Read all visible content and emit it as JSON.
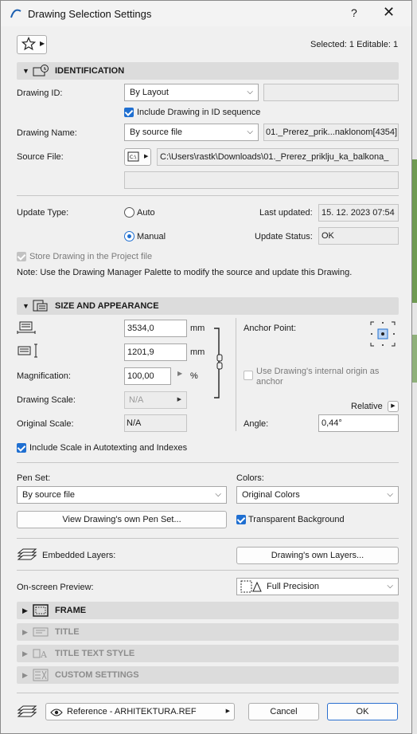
{
  "window": {
    "title": "Drawing Selection Settings",
    "help": "?",
    "close": "✕"
  },
  "status": {
    "selected": "Selected: 1 Editable: 1"
  },
  "identification": {
    "header": "IDENTIFICATION",
    "drawing_id_label": "Drawing ID:",
    "drawing_id_value": "By Layout",
    "drawing_id_extra": "",
    "include_id_label": "Include Drawing in ID sequence",
    "drawing_name_label": "Drawing Name:",
    "drawing_name_value": "By source file",
    "drawing_name_text": "01._Prerez_prik...naklonom[4354]",
    "source_file_label": "Source File:",
    "source_file_path": "C:\\Users\\rastk\\Downloads\\01._Prerez_priklju_ka_balkona_",
    "source_file_extra": "",
    "update_type_label": "Update Type:",
    "auto_label": "Auto",
    "manual_label": "Manual",
    "last_updated_label": "Last updated:",
    "last_updated_value": "15. 12. 2023 07:54",
    "update_status_label": "Update Status:",
    "update_status_value": "OK",
    "store_label": "Store Drawing in the Project file",
    "note": "Note: Use the Drawing Manager Palette to modify the source and update this Drawing."
  },
  "size": {
    "header": "SIZE AND APPEARANCE",
    "width_value": "3534,0",
    "height_value": "1201,9",
    "unit": "mm",
    "magnification_label": "Magnification:",
    "magnification_value": "100,00",
    "percent": "%",
    "drawing_scale_label": "Drawing Scale:",
    "drawing_scale_value": "N/A",
    "original_scale_label": "Original Scale:",
    "original_scale_value": "N/A",
    "anchor_label": "Anchor Point:",
    "internal_origin_label_1": "Use Drawing's internal origin as",
    "internal_origin_label_2": "anchor",
    "relative_label": "Relative",
    "angle_label": "Angle:",
    "angle_value": "0,44°",
    "include_scale_label": "Include Scale in Autotexting and Indexes"
  },
  "pens": {
    "pen_set_label": "Pen Set:",
    "pen_set_value": "By source file",
    "colors_label": "Colors:",
    "colors_value": "Original Colors",
    "view_pen_set_button": "View Drawing's own Pen Set...",
    "transparent_label": "Transparent Background"
  },
  "layers": {
    "embedded_label": "Embedded Layers:",
    "own_layers_button": "Drawing's own Layers..."
  },
  "preview": {
    "label": "On-screen Preview:",
    "value": "Full Precision"
  },
  "panels": [
    {
      "title": "FRAME"
    },
    {
      "title": "TITLE"
    },
    {
      "title": "TITLE TEXT STYLE"
    },
    {
      "title": "CUSTOM SETTINGS"
    }
  ],
  "footer": {
    "layer_value": "Reference - ARHITEKTURA.REF",
    "cancel": "Cancel",
    "ok": "OK"
  },
  "colors": {
    "accent": "#1f6fd1",
    "section_bg": "#dcdcdc",
    "dialog_bg": "#f0f0f0"
  }
}
